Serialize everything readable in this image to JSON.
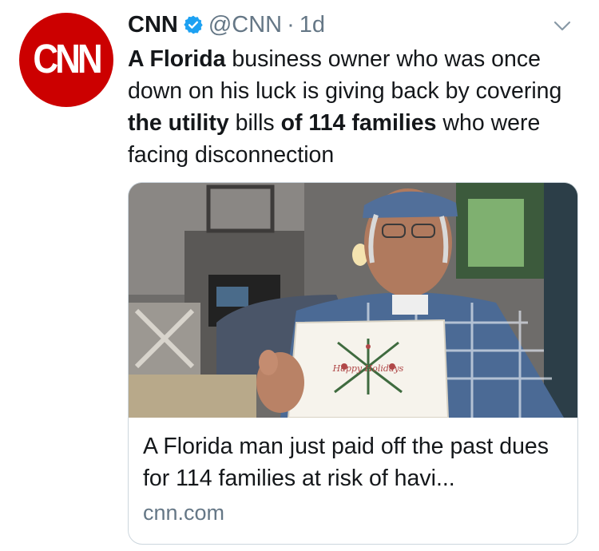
{
  "avatar": {
    "logo_text": "CNN",
    "color": "#cc0000"
  },
  "tweet": {
    "author_name": "CNN",
    "handle": "@CNN",
    "separator": "·",
    "time": "1d",
    "text_parts": [
      {
        "text": "A Florida",
        "bold": true
      },
      {
        "text": " business owner who was once down on his luck is giving back by covering ",
        "bold": false
      },
      {
        "text": "the utility",
        "bold": true
      },
      {
        "text": " bills ",
        "bold": false
      },
      {
        "text": "of 114 families",
        "bold": true
      },
      {
        "text": " who were facing disconnection",
        "bold": false
      }
    ]
  },
  "card": {
    "title": "A Florida man just paid off the past dues for 114 families at risk of havi...",
    "domain": "cnn.com",
    "photo_card_text": "Happy Holidays"
  },
  "colors": {
    "verified": "#1da1f2",
    "muted": "#657786",
    "border": "#ccd6dd"
  }
}
